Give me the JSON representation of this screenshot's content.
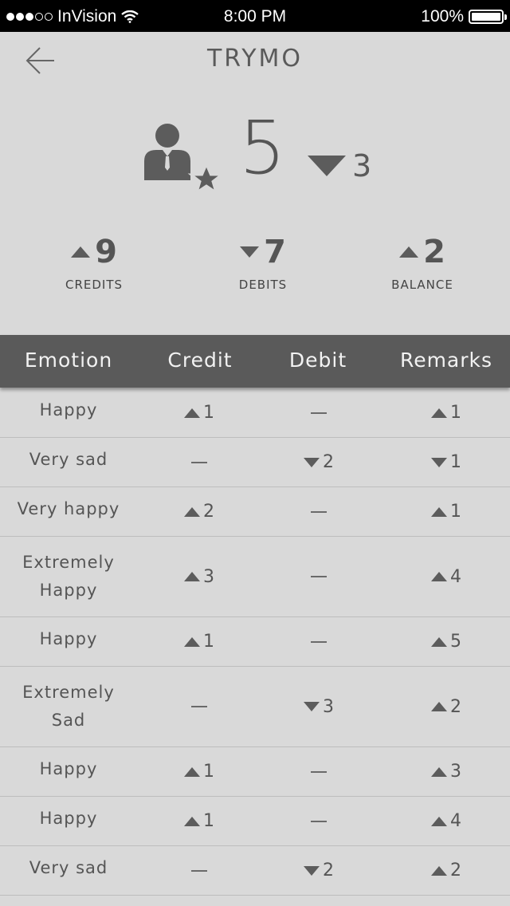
{
  "status_bar": {
    "carrier": "InVision",
    "time": "8:00 PM",
    "battery": "100%"
  },
  "header": {
    "title": "TRYMO"
  },
  "summary": {
    "score": "5",
    "change_direction": "down",
    "change_value": "3",
    "stats": [
      {
        "direction": "up",
        "value": "9",
        "label": "CREDITS"
      },
      {
        "direction": "down",
        "value": "7",
        "label": "DEBITS"
      },
      {
        "direction": "up",
        "value": "2",
        "label": "BALANCE"
      }
    ]
  },
  "table": {
    "headers": [
      "Emotion",
      "Credit",
      "Debit",
      "Remarks"
    ],
    "rows": [
      {
        "emotion": "Happy",
        "credit": {
          "dir": "up",
          "val": "1"
        },
        "debit": null,
        "remarks": {
          "dir": "up",
          "val": "1"
        }
      },
      {
        "emotion": "Very sad",
        "credit": null,
        "debit": {
          "dir": "down",
          "val": "2"
        },
        "remarks": {
          "dir": "down",
          "val": "1"
        }
      },
      {
        "emotion": "Very happy",
        "credit": {
          "dir": "up",
          "val": "2"
        },
        "debit": null,
        "remarks": {
          "dir": "up",
          "val": "1"
        }
      },
      {
        "emotion": "Extremely Happy",
        "credit": {
          "dir": "up",
          "val": "3"
        },
        "debit": null,
        "remarks": {
          "dir": "up",
          "val": "4"
        }
      },
      {
        "emotion": "Happy",
        "credit": {
          "dir": "up",
          "val": "1"
        },
        "debit": null,
        "remarks": {
          "dir": "up",
          "val": "5"
        }
      },
      {
        "emotion": "Extremely Sad",
        "credit": null,
        "debit": {
          "dir": "down",
          "val": "3"
        },
        "remarks": {
          "dir": "up",
          "val": "2"
        }
      },
      {
        "emotion": "Happy",
        "credit": {
          "dir": "up",
          "val": "1"
        },
        "debit": null,
        "remarks": {
          "dir": "up",
          "val": "3"
        }
      },
      {
        "emotion": "Happy",
        "credit": {
          "dir": "up",
          "val": "1"
        },
        "debit": null,
        "remarks": {
          "dir": "up",
          "val": "4"
        }
      },
      {
        "emotion": "Very sad",
        "credit": null,
        "debit": {
          "dir": "down",
          "val": "2"
        },
        "remarks": {
          "dir": "up",
          "val": "2"
        }
      }
    ]
  },
  "icons": {
    "back": "arrow-left-icon",
    "user": "user-star-icon",
    "wifi": "wifi-icon",
    "battery": "battery-icon"
  }
}
